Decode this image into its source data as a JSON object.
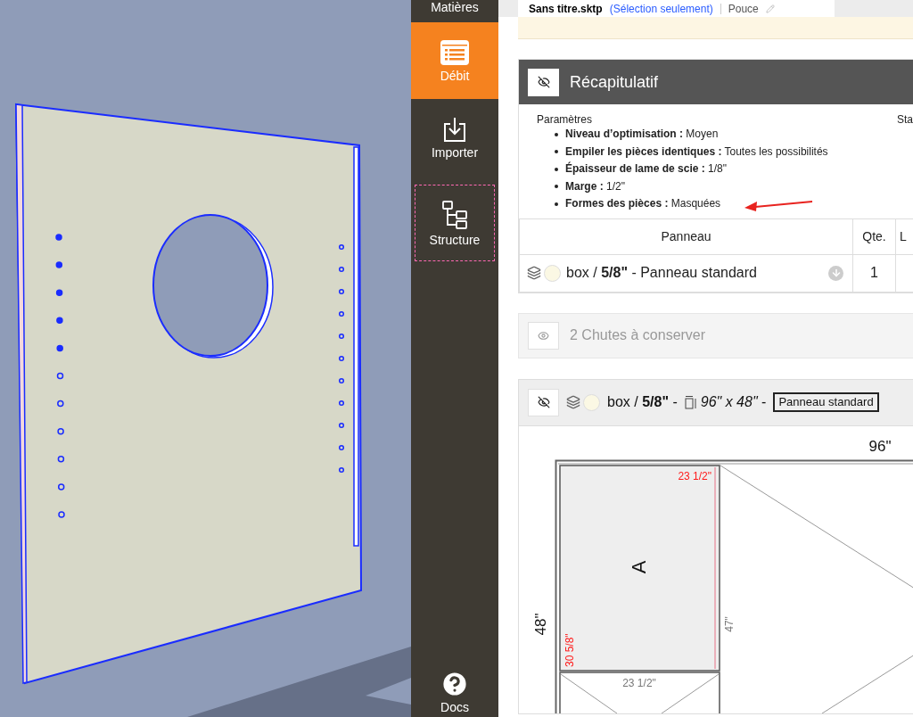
{
  "document_tab": {
    "filename": "Sans titre.sktp",
    "scope": "(Sélection seulement)",
    "unit": "Pouce"
  },
  "sidebar": {
    "items": [
      {
        "label": "Matières",
        "kind": "materials",
        "selected": false,
        "focused": false
      },
      {
        "label": "Débit",
        "kind": "cutlist",
        "selected": true,
        "focused": false
      },
      {
        "label": "Importer",
        "kind": "import",
        "selected": false,
        "focused": false
      },
      {
        "label": "Structure",
        "kind": "structure",
        "selected": false,
        "focused": true
      }
    ],
    "help": {
      "label": "Docs"
    }
  },
  "summary": {
    "title": "Récapitulatif",
    "collapsed": false,
    "parameters_heading": "Paramètres",
    "stats_heading": "Sta",
    "parameters": [
      "**Niveau d’optimisation :** Moyen",
      "**Empiler les pièces identiques :** Toutes les possibilités",
      "**Épaisseur de lame de scie :** 1/8\"",
      "**Marge :** 1/2\"",
      "**Formes des pièces :** Masquées"
    ],
    "table": {
      "columns": [
        "Panneau",
        "Qte.",
        "L"
      ],
      "rows": [
        {
          "panel": "box / **5/8\"** - Panneau standard",
          "quantity": "1"
        }
      ]
    }
  },
  "offcuts": {
    "title": "2 Chutes à conserver",
    "collapsed": true
  },
  "sheet": {
    "title": "box / **5/8\"** -",
    "size": "*96\" x 48\"* -",
    "type": "Panneau standard",
    "collapsed": false,
    "diagram": {
      "width_label": "96\"",
      "height_label": "48\"",
      "part": {
        "label": "A",
        "width": "23 1/2\"",
        "length": "30 5/8\""
      },
      "offcut_labels": [
        "47\"",
        "23 1/2\""
      ]
    }
  }
}
